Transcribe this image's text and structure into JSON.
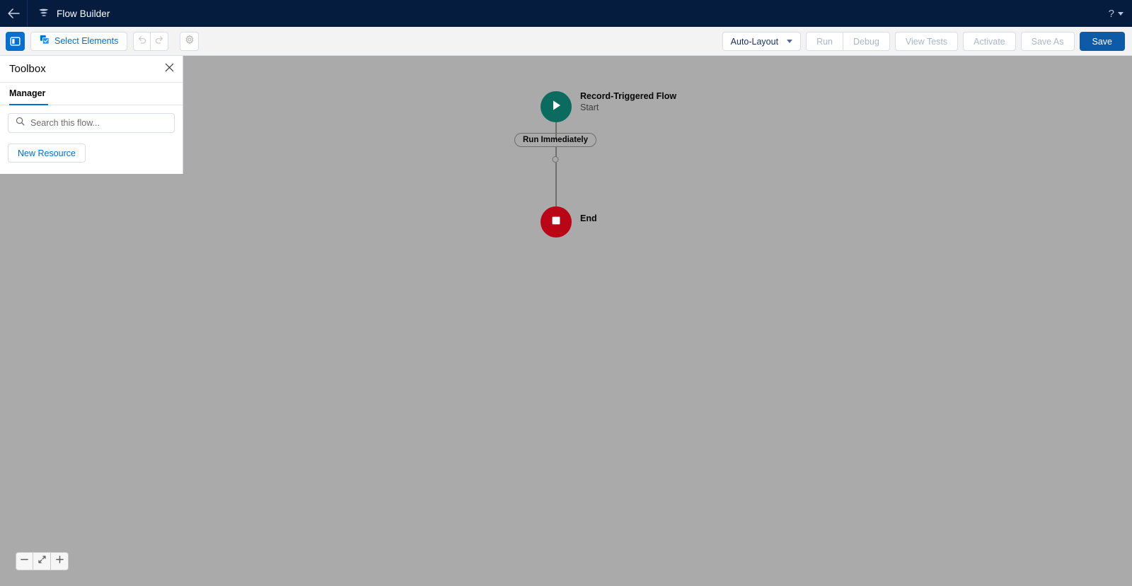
{
  "header": {
    "back_icon": "arrow-left-icon",
    "logo_icon": "flow-builder-logo-icon",
    "title": "Flow Builder",
    "help_label": "?",
    "help_icon": "help-icon",
    "caret_icon": "chevron-down-icon"
  },
  "toolbar": {
    "toggle_toolbox_icon": "panel-toggle-icon",
    "select_elements_label": "Select Elements",
    "select_elements_icon": "select-elements-icon",
    "undo_icon": "undo-icon",
    "redo_icon": "redo-icon",
    "settings_icon": "gear-icon",
    "layout_label": "Auto-Layout",
    "layout_caret_icon": "chevron-down-icon",
    "run_label": "Run",
    "debug_label": "Debug",
    "view_tests_label": "View Tests",
    "activate_label": "Activate",
    "save_as_label": "Save As",
    "save_label": "Save"
  },
  "toolbox": {
    "title": "Toolbox",
    "close_icon": "close-icon",
    "tab_manager_label": "Manager",
    "search_icon": "search-icon",
    "search_placeholder": "Search this flow...",
    "search_value": "",
    "new_resource_label": "New Resource"
  },
  "canvas": {
    "start_node": {
      "icon": "play-icon",
      "title": "Record-Triggered Flow",
      "subtitle": "Start",
      "color": "#0b6b5e"
    },
    "branch_pill_label": "Run Immediately",
    "add_element_icon": "add-element-node-icon",
    "end_node": {
      "icon": "stop-square-icon",
      "title": "End",
      "color": "#ba0517"
    },
    "background_color": "#aaaaab"
  },
  "zoom_controls": {
    "zoom_out_label": "−",
    "zoom_out_icon": "minus-icon",
    "fit_icon": "fit-to-view-icon",
    "zoom_in_label": "+",
    "zoom_in_icon": "plus-icon"
  }
}
